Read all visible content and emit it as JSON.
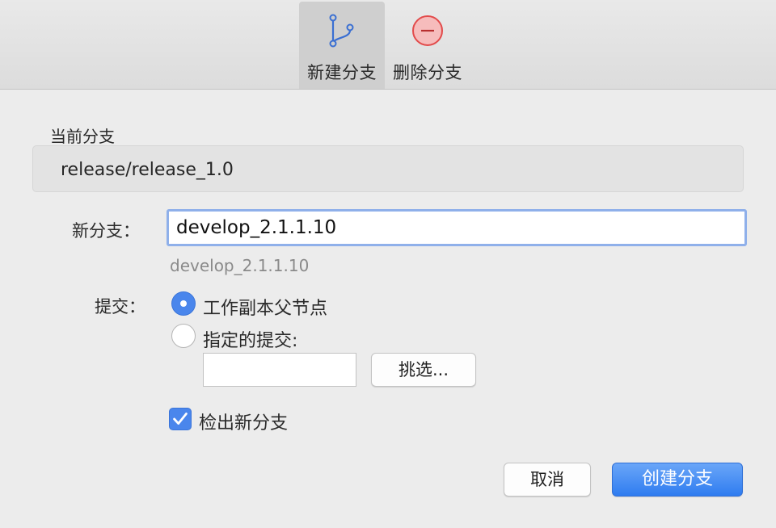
{
  "toolbar": {
    "new_branch_label": "新建分支",
    "delete_branch_label": "删除分支",
    "new_branch_icon": "branch-icon",
    "delete_branch_icon": "minus-circle-icon",
    "accent_color": "#3a6fd2",
    "delete_color": "#e24b4b"
  },
  "current_branch": {
    "label": "当前分支",
    "value": "release/release_1.0"
  },
  "new_branch": {
    "label": "新分支：",
    "value": "develop_2.1.1.10",
    "hint": "develop_2.1.1.10"
  },
  "commit": {
    "label": "提交：",
    "option_working_copy": "工作副本父节点",
    "option_specified": "指定的提交:",
    "selected": "working_copy",
    "commit_value": "",
    "pick_button": "挑选..."
  },
  "checkout": {
    "label": "检出新分支",
    "checked": true
  },
  "footer": {
    "cancel_label": "取消",
    "create_label": "创建分支"
  }
}
